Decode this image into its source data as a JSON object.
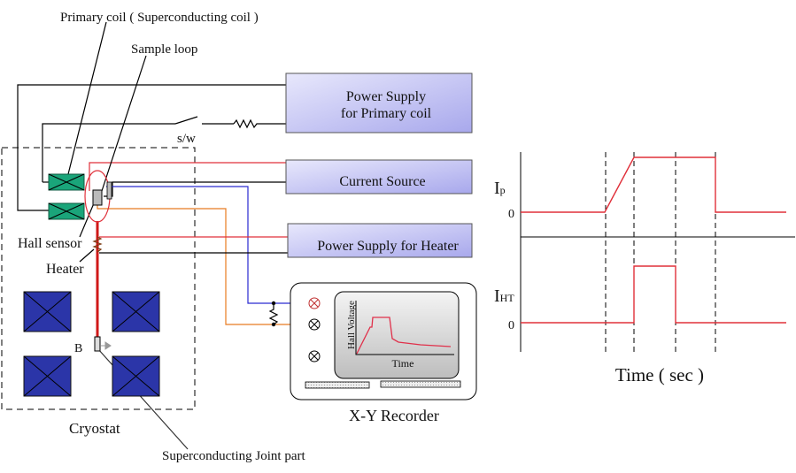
{
  "labels": {
    "primary_coil": "Primary coil ( Superconducting coil )",
    "sample_loop": "Sample loop",
    "switch": "s/w",
    "hall_sensor": "Hall sensor",
    "heater": "Heater",
    "field_b": "B",
    "cryostat": "Cryostat",
    "joint": "Superconducting Joint part",
    "recorder": "X-Y Recorder"
  },
  "boxes": {
    "primary_supply_line1": "Power Supply",
    "primary_supply_line2": "for Primary coil",
    "current_source": "Current Source",
    "heater_supply": "Power Supply for Heater"
  },
  "recorder_screen": {
    "ylabel": "Hall Voltage",
    "xlabel": "Time"
  },
  "timing": {
    "ip_label": "I",
    "ip_sub": "p",
    "iht_label": "I",
    "iht_sub": "HT",
    "zero": "0",
    "xlabel": "Time ( sec )"
  },
  "colors": {
    "box_fill": "#c8c8f4",
    "coil_green": "#1aa57a",
    "magnet_blue": "#2b35a8",
    "signal_red": "#e0303a",
    "blue_wire": "#2a2ad0",
    "orange_wire": "#e87b20"
  }
}
